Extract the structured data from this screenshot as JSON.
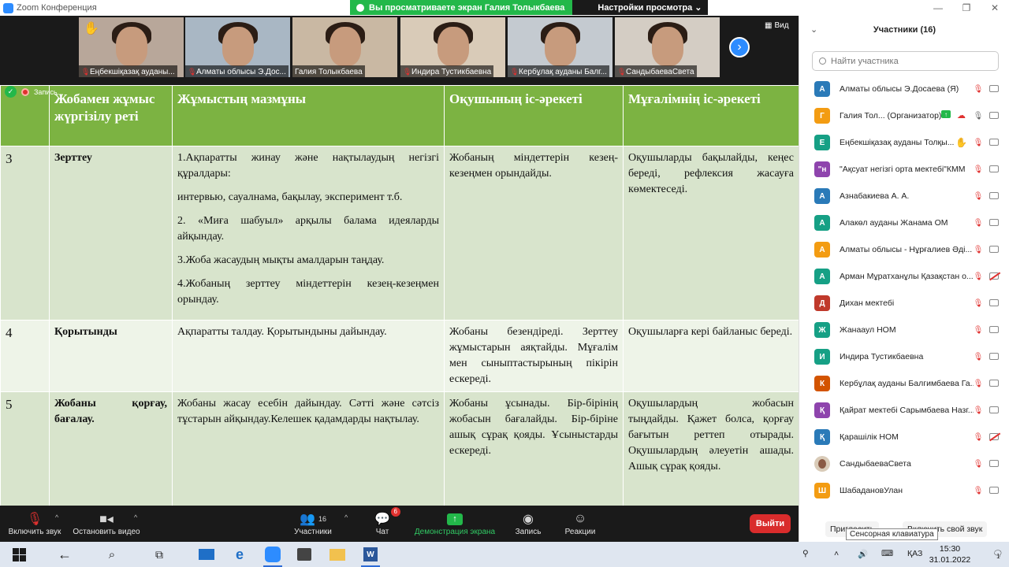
{
  "window": {
    "title": "Zoom Конференция"
  },
  "share_banner": {
    "viewing_text": "Вы просматриваете экран Галия Толыкбаева",
    "view_settings": "Настройки просмотра ⌄"
  },
  "video_strip": {
    "view_label": "Вид",
    "tiles": [
      {
        "name": "Еңбекшіқазақ ауданы...",
        "muted": true,
        "hand": true,
        "bg": "#b8a79a"
      },
      {
        "name": "Алматы облысы Э.Дос...",
        "muted": true,
        "hand": false,
        "bg": "#a9b7c4"
      },
      {
        "name": "Галия Толыкбаева",
        "muted": false,
        "hand": false,
        "bg": "#c9b8a3"
      },
      {
        "name": "Индира Тустикбаевна",
        "muted": true,
        "hand": false,
        "bg": "#d9cbb8"
      },
      {
        "name": "Кербұлақ ауданы Балг...",
        "muted": true,
        "hand": false,
        "bg": "#c4cad0"
      },
      {
        "name": "СандыбаеваСвета",
        "muted": true,
        "hand": false,
        "bg": "#d4cdc4"
      }
    ]
  },
  "recording_badge": {
    "label": "Запись..."
  },
  "doc_table": {
    "headers": [
      "№",
      "Жобамен жұмыс жүргізілу реті",
      "Жұмыстың мазмұны",
      "Оқушының іс-әрекеті",
      "Мұғалімнің іс-әрекеті"
    ],
    "rows": [
      {
        "num": "3",
        "stage": "Зерттеу",
        "content": [
          "1.Ақпаратты жинау және нақтылаудың негізгі құралдары:",
          "интервью, сауалнама, бақылау, эксперимент т.б.",
          "2. «Миға шабуыл» арқылы балама идеяларды айқындау.",
          "3.Жоба жасаудың мықты амалдарын таңдау.",
          "4.Жобаның зерттеу міндеттерін кезең-кезеңмен орындау."
        ],
        "student": "Жобаның міндеттерін кезең-кезеңмен орындайды.",
        "teacher": "Оқушыларды бақылайды, кеңес береді, рефлексия жасауға көмектеседі."
      },
      {
        "num": "4",
        "stage": "Қорытынды",
        "content": [
          "Ақпаратты талдау. Қорытындыны дайындау."
        ],
        "student": "Жобаны безендіреді. Зерттеу жұмыстарын аяқтайды. Мұғалім мен сыныптастырының пікірін ескереді.",
        "teacher": "Оқушыларға кері байланыс береді."
      },
      {
        "num": "5",
        "stage": "Жобаны қорғау, бағалау.",
        "content": [
          "Жобаны жасау есебін дайындау. Сәтті және сәтсіз тұстарын айқындау.Келешек қадамдарды нақтылау."
        ],
        "student": "Жобаны ұсынады. Бір-бірінің жобасын бағалайды. Бір-біріне ашық сұрақ қояды. Ұсыныстарды ескереді.",
        "teacher": "Оқушылардың жобасын тыңдайды. Қажет болса, қорғау бағытын реттеп отырады. Оқушылардың әлеуетін ашады. Ашық сұрақ қояды."
      }
    ]
  },
  "toolbar": {
    "unmute": "Включить звук",
    "start_video": "Остановить видео",
    "participants": "Участники",
    "participants_count": "16",
    "chat": "Чат",
    "chat_badge": "6",
    "share_screen": "Демонстрация экрана",
    "record": "Запись",
    "reactions": "Реакции",
    "leave": "Выйти"
  },
  "participants_panel": {
    "title": "Участники (16)",
    "search_placeholder": "Найти участника",
    "invite": "Пригласить",
    "unmute_me": "Включить свой звук",
    "tooltip": "Сенсорная клавиатура",
    "items": [
      {
        "initial": "А",
        "color": "#2a7ab8",
        "name": "Алматы облысы Э.Досаева (Я)",
        "mic": "off",
        "cam": "on"
      },
      {
        "initial": "Г",
        "color": "#f39c12",
        "name": "Галия Тол... (Организатор)",
        "mic": "on",
        "cam": "on",
        "share": true
      },
      {
        "initial": "Е",
        "color": "#16a085",
        "name": "Еңбекшіқазақ ауданы Толқы...",
        "mic": "off",
        "cam": "on",
        "hand": true
      },
      {
        "initial": "\"н",
        "color": "#8e44ad",
        "name": "\"Ақсуат негізгі орта мектебі\"КММ",
        "mic": "off",
        "cam": "on"
      },
      {
        "initial": "А",
        "color": "#2a7ab8",
        "name": "Азнабакиева А. А.",
        "mic": "off",
        "cam": "on"
      },
      {
        "initial": "А",
        "color": "#16a085",
        "name": "Алакөл ауданы Жанама ОМ",
        "mic": "off",
        "cam": "on"
      },
      {
        "initial": "А",
        "color": "#f39c12",
        "name": "Алматы облысы - Нұрғалиев Әді...",
        "mic": "off",
        "cam": "on"
      },
      {
        "initial": "А",
        "color": "#16a085",
        "name": "Арман Мұратханұлы Қазақстан о...",
        "mic": "off",
        "cam": "off"
      },
      {
        "initial": "Д",
        "color": "#c0392b",
        "name": "Дихан мектебі",
        "mic": "off",
        "cam": "on"
      },
      {
        "initial": "Ж",
        "color": "#16a085",
        "name": "Жанааул НОМ",
        "mic": "off",
        "cam": "on"
      },
      {
        "initial": "И",
        "color": "#16a085",
        "name": "Индира Тустикбаевна",
        "mic": "off",
        "cam": "on"
      },
      {
        "initial": "К",
        "color": "#d35400",
        "name": "Кербұлақ ауданы Балгимбаева Га...",
        "mic": "off",
        "cam": "on"
      },
      {
        "initial": "Қ",
        "color": "#8e44ad",
        "name": "Қайрат мектебі Сарымбаева Назг...",
        "mic": "off",
        "cam": "on"
      },
      {
        "initial": "Қ",
        "color": "#2a7ab8",
        "name": "Қарашілік НОМ",
        "mic": "off",
        "cam": "off"
      },
      {
        "initial": "",
        "color": "#d9cbb8",
        "name": "СандыбаеваСвета",
        "mic": "off",
        "cam": "on",
        "photo": true
      },
      {
        "initial": "Ш",
        "color": "#f39c12",
        "name": "ШабадановУлан",
        "mic": "off",
        "cam": "on"
      }
    ]
  },
  "taskbar": {
    "language": "ҚАЗ",
    "time": "15:30",
    "date": "31.01.2022",
    "notifications": "1"
  }
}
